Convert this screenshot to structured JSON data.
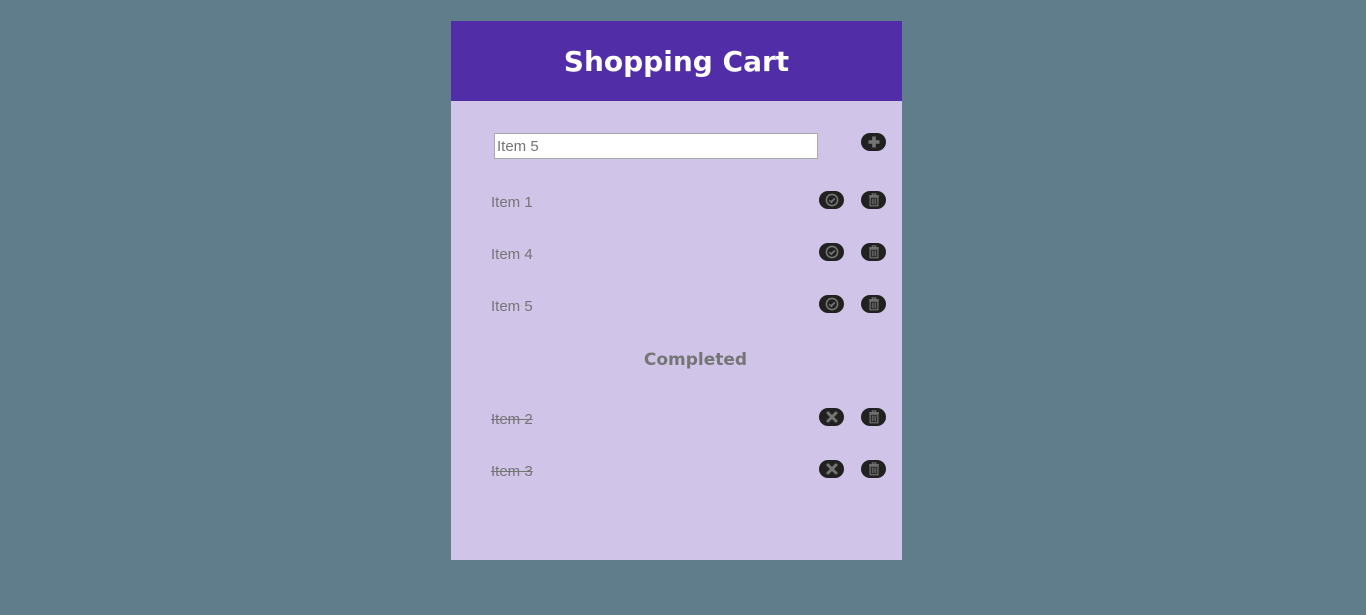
{
  "header": {
    "title": "Shopping Cart"
  },
  "add_form": {
    "input_value": "Item 5",
    "add_button_icon": "plus-icon"
  },
  "todo": {
    "items": [
      {
        "label": "Item 1",
        "complete_icon": "check-circle-icon",
        "delete_icon": "trash-icon"
      },
      {
        "label": "Item 4",
        "complete_icon": "check-circle-icon",
        "delete_icon": "trash-icon"
      },
      {
        "label": "Item 5",
        "complete_icon": "check-circle-icon",
        "delete_icon": "trash-icon"
      }
    ]
  },
  "completed": {
    "heading": "Completed",
    "items": [
      {
        "label": "Item 2",
        "undo_icon": "x-icon",
        "delete_icon": "trash-icon"
      },
      {
        "label": "Item 3",
        "undo_icon": "x-icon",
        "delete_icon": "trash-icon"
      }
    ]
  },
  "colors": {
    "page_bg": "#607d8b",
    "header_bg": "#512da8",
    "panel_bg": "#d1c4e9",
    "button_bg": "#212121",
    "icon_gray": "#757575",
    "text_gray": "#757575"
  }
}
